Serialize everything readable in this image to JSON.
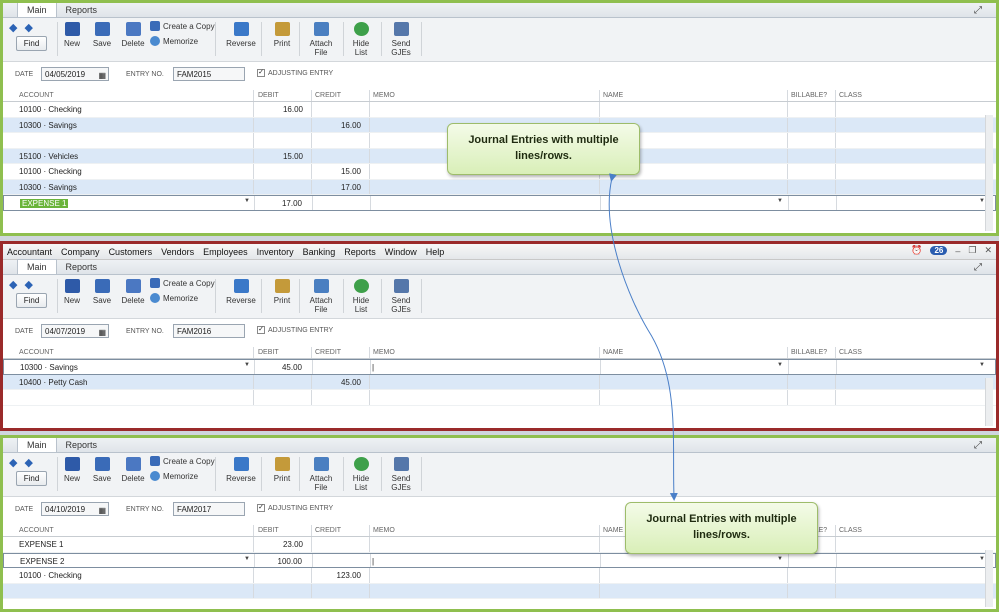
{
  "menubar": {
    "items": [
      "Accountant",
      "Company",
      "Customers",
      "Vendors",
      "Employees",
      "Inventory",
      "Banking",
      "Reports",
      "Window",
      "Help"
    ],
    "badge": "26"
  },
  "toolbar": {
    "find": "Find",
    "new": "New",
    "save": "Save",
    "delete": "Delete",
    "create_copy": "Create a Copy",
    "memorize": "Memorize",
    "reverse": "Reverse",
    "print": "Print",
    "attach": "Attach File",
    "hide_list": "Hide List",
    "send": "Send GJEs"
  },
  "tabs": {
    "main": "Main",
    "reports": "Reports"
  },
  "labels": {
    "date": "DATE",
    "entry_no": "ENTRY NO.",
    "adjusting": "ADJUSTING ENTRY"
  },
  "columns": {
    "account": "ACCOUNT",
    "debit": "DEBIT",
    "credit": "CREDIT",
    "memo": "MEMO",
    "name": "NAME",
    "billable": "BILLABLE?",
    "class": "CLASS"
  },
  "entries": [
    {
      "date": "04/05/2019",
      "entry_no": "FAM2015",
      "rows": [
        {
          "account": "10100 · Checking",
          "debit": "16.00",
          "credit": ""
        },
        {
          "account": "10300 · Savings",
          "debit": "",
          "credit": "16.00"
        },
        {
          "account": "",
          "debit": "",
          "credit": ""
        },
        {
          "account": "15100 · Vehicles",
          "debit": "15.00",
          "credit": ""
        },
        {
          "account": "10100 · Checking",
          "debit": "",
          "credit": "15.00"
        },
        {
          "account": "10300 · Savings",
          "debit": "",
          "credit": "17.00"
        },
        {
          "account": "EXPENSE 1",
          "debit": "17.00",
          "credit": ""
        }
      ]
    },
    {
      "date": "04/07/2019",
      "entry_no": "FAM2016",
      "rows": [
        {
          "account": "10300 · Savings",
          "debit": "45.00",
          "credit": ""
        },
        {
          "account": "10400 · Petty Cash",
          "debit": "",
          "credit": "45.00"
        }
      ]
    },
    {
      "date": "04/10/2019",
      "entry_no": "FAM2017",
      "rows": [
        {
          "account": "EXPENSE 1",
          "debit": "23.00",
          "credit": ""
        },
        {
          "account": "EXPENSE 2",
          "debit": "100.00",
          "credit": ""
        },
        {
          "account": "10100 · Checking",
          "debit": "",
          "credit": "123.00"
        }
      ]
    }
  ],
  "callouts": {
    "top": "Journal Entries with multiple lines/rows.",
    "bottom": "Journal Entries with multiple lines/rows."
  }
}
